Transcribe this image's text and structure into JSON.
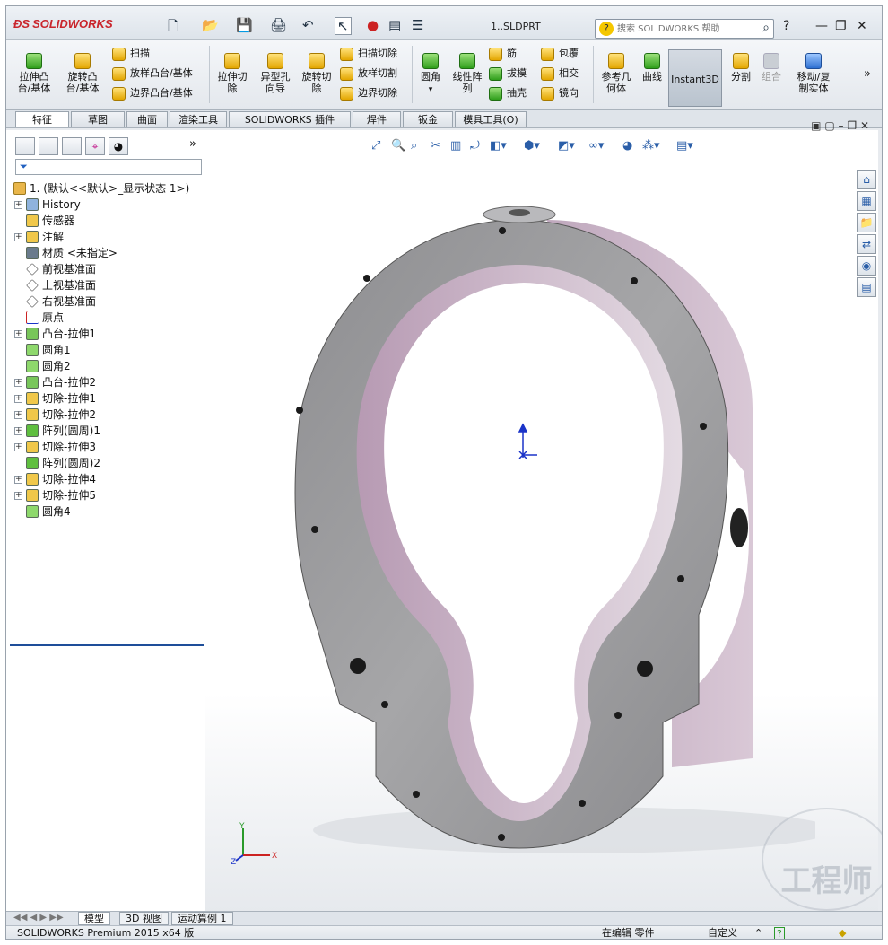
{
  "window": {
    "brand": "SOLIDWORKS",
    "document_title": "1..SLDPRT",
    "help_search_placeholder": "搜索 SOLIDWORKS 帮助"
  },
  "ribbon": {
    "big_buttons": [
      {
        "label1": "拉伸凸",
        "label2": "台/基体"
      },
      {
        "label1": "旋转凸",
        "label2": "台/基体"
      },
      {
        "label1": "拉伸切",
        "label2": "除"
      },
      {
        "label1": "异型孔",
        "label2": "向导"
      },
      {
        "label1": "旋转切",
        "label2": "除"
      },
      {
        "label1": "圆角",
        "label2": ""
      },
      {
        "label1": "线性阵",
        "label2": "列"
      },
      {
        "label1": "参考几",
        "label2": "何体"
      },
      {
        "label1": "曲线",
        "label2": ""
      },
      {
        "label1": "分割",
        "label2": ""
      },
      {
        "label1": "组合",
        "label2": ""
      },
      {
        "label1": "移动/复",
        "label2": "制实体"
      }
    ],
    "small_buttons": {
      "sweep": "扫描",
      "loft": "放样凸台/基体",
      "boundary": "边界凸台/基体",
      "sweep_cut": "扫描切除",
      "loft_cut": "放样切割",
      "boundary_cut": "边界切除",
      "rib": "筋",
      "draft": "拔模",
      "shell": "抽壳",
      "wrap": "包覆",
      "intersect": "相交",
      "mirror": "镜向"
    },
    "instant3d": "Instant3D"
  },
  "tabs": [
    "特征",
    "草图",
    "曲面",
    "渲染工具",
    "SOLIDWORKS 插件",
    "焊件(D)",
    "钣金(H)",
    "模具工具(O)"
  ],
  "tree": {
    "root": "1. (默认<<默认>_显示状态 1>)",
    "items": [
      {
        "label": "History",
        "expand": true,
        "icon": "history-icon"
      },
      {
        "label": "传感器",
        "expand": false,
        "icon": "sensor-icon"
      },
      {
        "label": "注解",
        "expand": true,
        "icon": "annotation-icon"
      },
      {
        "label": "材质 <未指定>",
        "expand": false,
        "icon": "material-icon"
      },
      {
        "label": "前视基准面",
        "expand": false,
        "icon": "plane-icon"
      },
      {
        "label": "上视基准面",
        "expand": false,
        "icon": "plane-icon"
      },
      {
        "label": "右视基准面",
        "expand": false,
        "icon": "plane-icon"
      },
      {
        "label": "原点",
        "expand": false,
        "icon": "origin-icon"
      },
      {
        "label": "凸台-拉伸1",
        "expand": true,
        "icon": "boss-extrude-icon"
      },
      {
        "label": "圆角1",
        "expand": false,
        "icon": "fillet-icon"
      },
      {
        "label": "圆角2",
        "expand": false,
        "icon": "fillet-icon"
      },
      {
        "label": "凸台-拉伸2",
        "expand": true,
        "icon": "boss-extrude-icon"
      },
      {
        "label": "切除-拉伸1",
        "expand": true,
        "icon": "cut-extrude-icon"
      },
      {
        "label": "切除-拉伸2",
        "expand": true,
        "icon": "cut-extrude-icon"
      },
      {
        "label": "阵列(圆周)1",
        "expand": true,
        "icon": "circular-pattern-icon"
      },
      {
        "label": "切除-拉伸3",
        "expand": true,
        "icon": "cut-extrude-icon"
      },
      {
        "label": "阵列(圆周)2",
        "expand": false,
        "icon": "circular-pattern-icon"
      },
      {
        "label": "切除-拉伸4",
        "expand": true,
        "icon": "cut-extrude-icon"
      },
      {
        "label": "切除-拉伸5",
        "expand": true,
        "icon": "cut-extrude-icon"
      },
      {
        "label": "圆角4",
        "expand": false,
        "icon": "fillet-icon"
      }
    ]
  },
  "bottom_tabs": [
    "模型",
    "3D 视图",
    "运动算例 1"
  ],
  "status": {
    "product": "SOLIDWORKS Premium 2015 x64 版",
    "editing": "在编辑 零件",
    "units": "自定义"
  },
  "triad_labels": {
    "x": "X",
    "y": "Y",
    "z": "Z"
  },
  "watermark": "工程师",
  "colors": {
    "accent": "#1e4e99",
    "part_face": "#9a9a9c",
    "part_side": "#c7b3c4"
  }
}
